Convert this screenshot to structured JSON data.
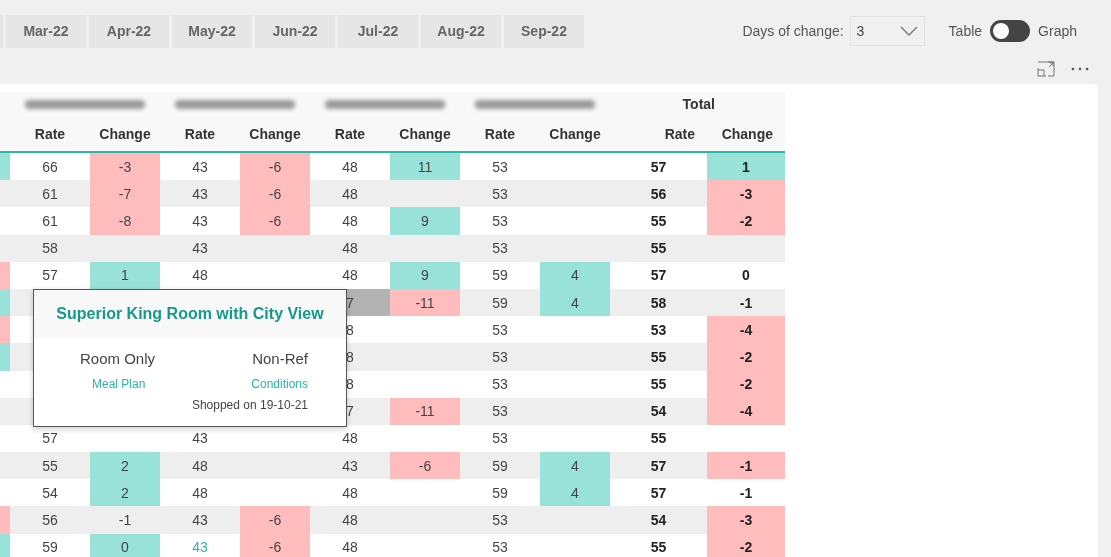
{
  "month_tabs": [
    "Mar-22",
    "Apr-22",
    "May-22",
    "Jun-22",
    "Jul-22",
    "Aug-22",
    "Sep-22"
  ],
  "days_of_change": {
    "label": "Days of change:",
    "value": "3"
  },
  "view_toggle": {
    "left_label": "Table",
    "right_label": "Graph",
    "on": false
  },
  "table": {
    "total_group": "Total",
    "columns": [
      "Rate",
      "Change",
      "Rate",
      "Change",
      "Rate",
      "Change",
      "Rate",
      "Change",
      "Rate",
      "Change"
    ],
    "rows": [
      {
        "edge": {
          "color": "#98e2da"
        },
        "cells": [
          {
            "text": "66"
          },
          {
            "text": "-3",
            "color": "#ffbcbc"
          },
          {
            "text": "43"
          },
          {
            "text": "-6",
            "color": "#ffbcbc"
          },
          {
            "text": "48"
          },
          {
            "text": "11",
            "color": "#98e2da"
          },
          {
            "text": "53"
          },
          {},
          {
            "text": "57"
          },
          {
            "text": "1",
            "color": "#98e2da"
          }
        ]
      },
      {
        "cells": [
          {
            "text": "61"
          },
          {
            "text": "-7",
            "color": "#ffbcbc"
          },
          {
            "text": "43"
          },
          {
            "text": "-6",
            "color": "#ffbcbc"
          },
          {
            "text": "48"
          },
          {},
          {
            "text": "53"
          },
          {},
          {
            "text": "56"
          },
          {
            "text": "-3",
            "color": "#ffbcbc"
          }
        ]
      },
      {
        "cells": [
          {
            "text": "61"
          },
          {
            "text": "-8",
            "color": "#ffbcbc"
          },
          {
            "text": "43"
          },
          {
            "text": "-6",
            "color": "#ffbcbc"
          },
          {
            "text": "48"
          },
          {
            "text": "9",
            "color": "#98e2da"
          },
          {
            "text": "53"
          },
          {},
          {
            "text": "55"
          },
          {
            "text": "-2",
            "color": "#ffbcbc"
          }
        ]
      },
      {
        "cells": [
          {
            "text": "58"
          },
          {},
          {
            "text": "43"
          },
          {},
          {
            "text": "48"
          },
          {},
          {
            "text": "53"
          },
          {},
          {
            "text": "55"
          },
          {}
        ]
      },
      {
        "edge": {
          "color": "#ffbcbc"
        },
        "cells": [
          {
            "text": "57"
          },
          {
            "text": "1",
            "color": "#98e2da"
          },
          {
            "text": "48"
          },
          {},
          {
            "text": "48"
          },
          {
            "text": "9",
            "color": "#98e2da"
          },
          {
            "text": "59"
          },
          {
            "text": "4",
            "color": "#98e2da"
          },
          {
            "text": "57"
          },
          {
            "text": "0"
          }
        ]
      },
      {
        "edge": {
          "color": "#98e2da"
        },
        "cells": [
          {},
          {},
          {},
          {},
          {
            "text": "7",
            "color": "#b3b3b3"
          },
          {
            "text": "-11",
            "color": "#ffbcbc"
          },
          {
            "text": "59"
          },
          {
            "text": "4",
            "color": "#98e2da"
          },
          {
            "text": "58"
          },
          {
            "text": "-1"
          }
        ]
      },
      {
        "edge": {
          "color": "#ffbcbc"
        },
        "cells": [
          {},
          {},
          {},
          {},
          {
            "text": "8"
          },
          {},
          {
            "text": "53"
          },
          {},
          {
            "text": "53"
          },
          {
            "text": "-4",
            "color": "#ffbcbc"
          }
        ]
      },
      {
        "edge": {
          "color": "#98e2da"
        },
        "cells": [
          {},
          {},
          {},
          {},
          {
            "text": "8"
          },
          {},
          {
            "text": "53"
          },
          {},
          {
            "text": "55"
          },
          {
            "text": "-2",
            "color": "#ffbcbc"
          }
        ]
      },
      {
        "cells": [
          {},
          {},
          {},
          {},
          {
            "text": "8"
          },
          {},
          {
            "text": "53"
          },
          {},
          {
            "text": "55"
          },
          {
            "text": "-2",
            "color": "#ffbcbc"
          }
        ]
      },
      {
        "cells": [
          {},
          {},
          {},
          {},
          {
            "text": "7"
          },
          {
            "text": "-11",
            "color": "#ffbcbc"
          },
          {
            "text": "53"
          },
          {},
          {
            "text": "54"
          },
          {
            "text": "-4",
            "color": "#ffbcbc"
          }
        ]
      },
      {
        "cells": [
          {
            "text": "57"
          },
          {},
          {
            "text": "43"
          },
          {},
          {
            "text": "48"
          },
          {},
          {
            "text": "53"
          },
          {},
          {
            "text": "55"
          },
          {}
        ]
      },
      {
        "cells": [
          {
            "text": "55"
          },
          {
            "text": "2",
            "color": "#98e2da"
          },
          {
            "text": "48"
          },
          {},
          {
            "text": "43"
          },
          {
            "text": "-6",
            "color": "#ffbcbc"
          },
          {
            "text": "59"
          },
          {
            "text": "4",
            "color": "#98e2da"
          },
          {
            "text": "57"
          },
          {
            "text": "-1",
            "color": "#ffbcbc"
          }
        ]
      },
      {
        "cells": [
          {
            "text": "54"
          },
          {
            "text": "2",
            "color": "#98e2da"
          },
          {
            "text": "48"
          },
          {},
          {
            "text": "48"
          },
          {},
          {
            "text": "59"
          },
          {
            "text": "4",
            "color": "#98e2da"
          },
          {
            "text": "57"
          },
          {
            "text": "-1"
          }
        ]
      },
      {
        "edge": {
          "color": "#ffbcbc"
        },
        "cells": [
          {
            "text": "56"
          },
          {
            "text": "-1"
          },
          {
            "text": "43"
          },
          {
            "text": "-6",
            "color": "#ffbcbc"
          },
          {
            "text": "48"
          },
          {},
          {
            "text": "53"
          },
          {},
          {
            "text": "54"
          },
          {
            "text": "-3",
            "color": "#ffbcbc"
          }
        ]
      },
      {
        "edge": {
          "color": "#98e2da"
        },
        "cells": [
          {
            "text": "59"
          },
          {
            "text": "0",
            "color": "#98e2da"
          },
          {
            "text": "43",
            "font": {
              "color": "#2ab5a5"
            }
          },
          {
            "text": "-6",
            "color": "#ffbcbc"
          },
          {
            "text": "48"
          },
          {},
          {
            "text": "53"
          },
          {},
          {
            "text": "55"
          },
          {
            "text": "-2",
            "color": "#ffbcbc"
          }
        ]
      }
    ]
  },
  "tooltip": {
    "title": "Superior King Room with City View",
    "meal_plan": "Room Only",
    "meal_plan_label": "Meal Plan",
    "conditions": "Non-Ref",
    "conditions_label": "Conditions",
    "shopped": "Shopped on 19-10-21"
  }
}
